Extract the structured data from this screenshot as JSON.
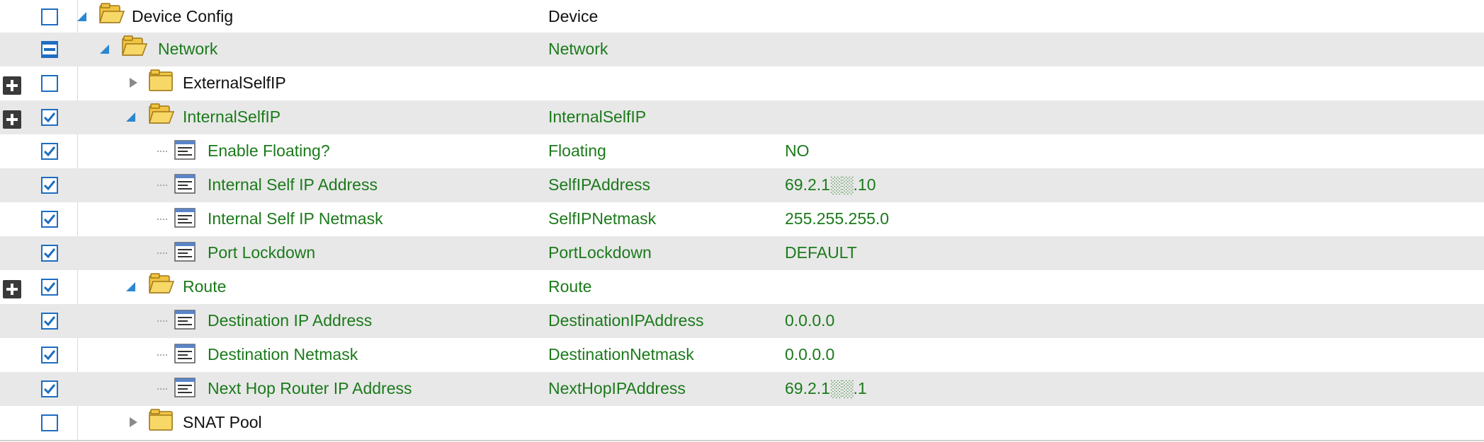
{
  "colors": {
    "accent": "#1e6dc1",
    "green_text": "#1b7a1b",
    "alt_row": "#e8e8e8",
    "folder": "#f2c744"
  },
  "rows": [
    {
      "name": "Device Config",
      "key": "Device",
      "value": ""
    },
    {
      "name": "Network",
      "key": "Network",
      "value": ""
    },
    {
      "name": "ExternalSelfIP",
      "key": "",
      "value": ""
    },
    {
      "name": "InternalSelfIP",
      "key": "InternalSelfIP",
      "value": ""
    },
    {
      "name": "Enable Floating?",
      "key": "Floating",
      "value": "NO"
    },
    {
      "name": "Internal Self IP Address",
      "key": "SelfIPAddress",
      "value": "69.2.1░░.10"
    },
    {
      "name": "Internal Self IP Netmask",
      "key": "SelfIPNetmask",
      "value": "255.255.255.0"
    },
    {
      "name": "Port Lockdown",
      "key": "PortLockdown",
      "value": "DEFAULT"
    },
    {
      "name": "Route",
      "key": "Route",
      "value": ""
    },
    {
      "name": "Destination IP Address",
      "key": "DestinationIPAddress",
      "value": "0.0.0.0"
    },
    {
      "name": "Destination Netmask",
      "key": "DestinationNetmask",
      "value": "0.0.0.0"
    },
    {
      "name": "Next Hop Router IP Address",
      "key": "NextHopIPAddress",
      "value": "69.2.1░░.1"
    },
    {
      "name": "SNAT Pool",
      "key": "",
      "value": ""
    }
  ]
}
